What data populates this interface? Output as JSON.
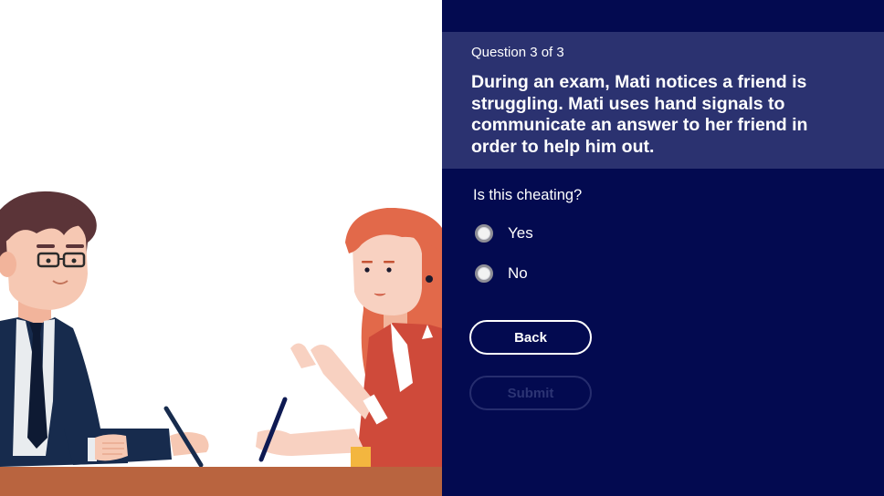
{
  "question": {
    "counter": "Question 3 of 3",
    "text": "During an exam, Mati notices a friend is struggling. Mati uses hand signals to communicate an answer to her friend in order to help him out.",
    "prompt": "Is this cheating?"
  },
  "options": [
    {
      "label": "Yes",
      "selected": false
    },
    {
      "label": "No",
      "selected": false
    }
  ],
  "buttons": {
    "back_label": "Back",
    "submit_label": "Submit",
    "submit_enabled": false
  },
  "colors": {
    "panel_bg": "#030a50",
    "header_bg": "#2b3270",
    "table": "#b9643f",
    "man_suit": "#172b4d",
    "woman_hair": "#e2694a",
    "woman_shirt": "#cf4a3a"
  },
  "illustration": {
    "description_icons": [
      "man-character",
      "woman-character",
      "desk",
      "pencil-icon"
    ]
  }
}
